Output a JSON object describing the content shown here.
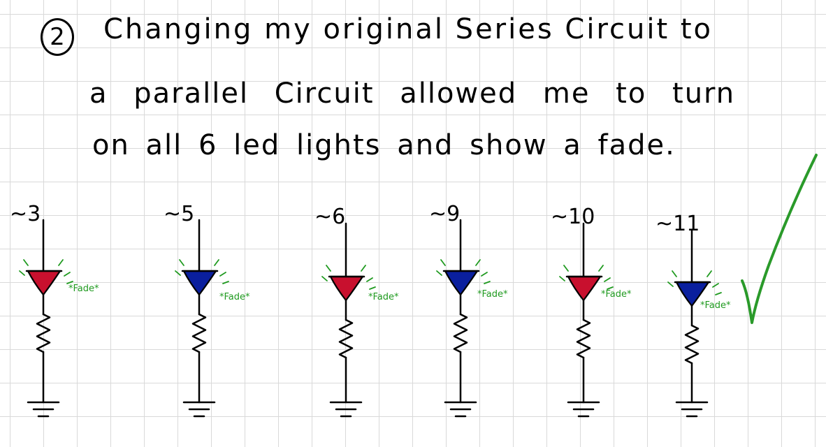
{
  "note": {
    "step_number": "2",
    "lines": [
      "Changing my original Series Circuit to",
      "a parallel Circuit allowed me to turn",
      "on all 6 led lights and show a fade."
    ]
  },
  "circuits": [
    {
      "pin": "~3",
      "led_color": "#c8102e",
      "fade_label": "*Fade*"
    },
    {
      "pin": "~5",
      "led_color": "#0a1f9e",
      "fade_label": "*Fade*"
    },
    {
      "pin": "~6",
      "led_color": "#c8102e",
      "fade_label": "*Fade*"
    },
    {
      "pin": "~9",
      "led_color": "#0a1f9e",
      "fade_label": "*Fade*"
    },
    {
      "pin": "~10",
      "led_color": "#c8102e",
      "fade_label": "*Fade*"
    },
    {
      "pin": "~11",
      "led_color": "#0a1f9e",
      "fade_label": "*Fade*"
    }
  ],
  "colors": {
    "ink": "#000000",
    "annotation": "#1f9a1f",
    "check": "#2a9a2a"
  },
  "icons": {
    "check": "checkmark-icon",
    "led": "led-icon",
    "resistor": "resistor-icon",
    "ground": "ground-icon"
  }
}
